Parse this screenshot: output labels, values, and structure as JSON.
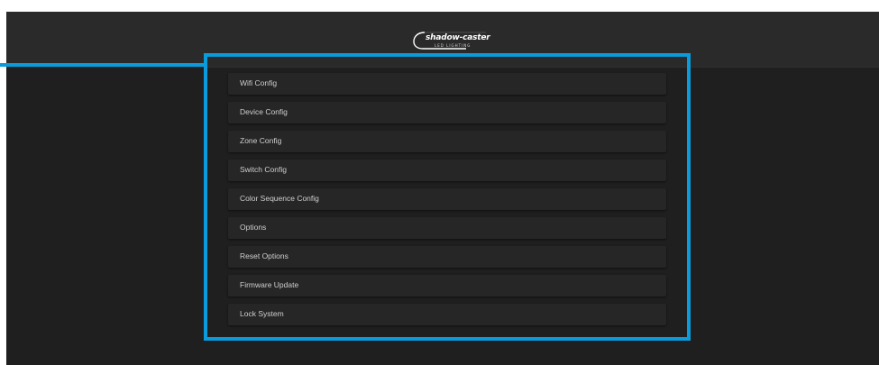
{
  "header": {
    "logo_text": "shadow-caster",
    "logo_subtext": "LED LIGHTING"
  },
  "menu": {
    "items": [
      {
        "label": "Wifi Config"
      },
      {
        "label": "Device Config"
      },
      {
        "label": "Zone Config"
      },
      {
        "label": "Switch Config"
      },
      {
        "label": "Color Sequence Config"
      },
      {
        "label": "Options"
      },
      {
        "label": "Reset Options"
      },
      {
        "label": "Firmware Update"
      },
      {
        "label": "Lock System"
      }
    ]
  },
  "annotation": {
    "highlight_color": "#0a9bdc"
  },
  "theme": {
    "background": "#1f1f1f",
    "header_background": "#2a2a2a",
    "item_background": "#262626",
    "item_text": "#cfcfcf"
  }
}
